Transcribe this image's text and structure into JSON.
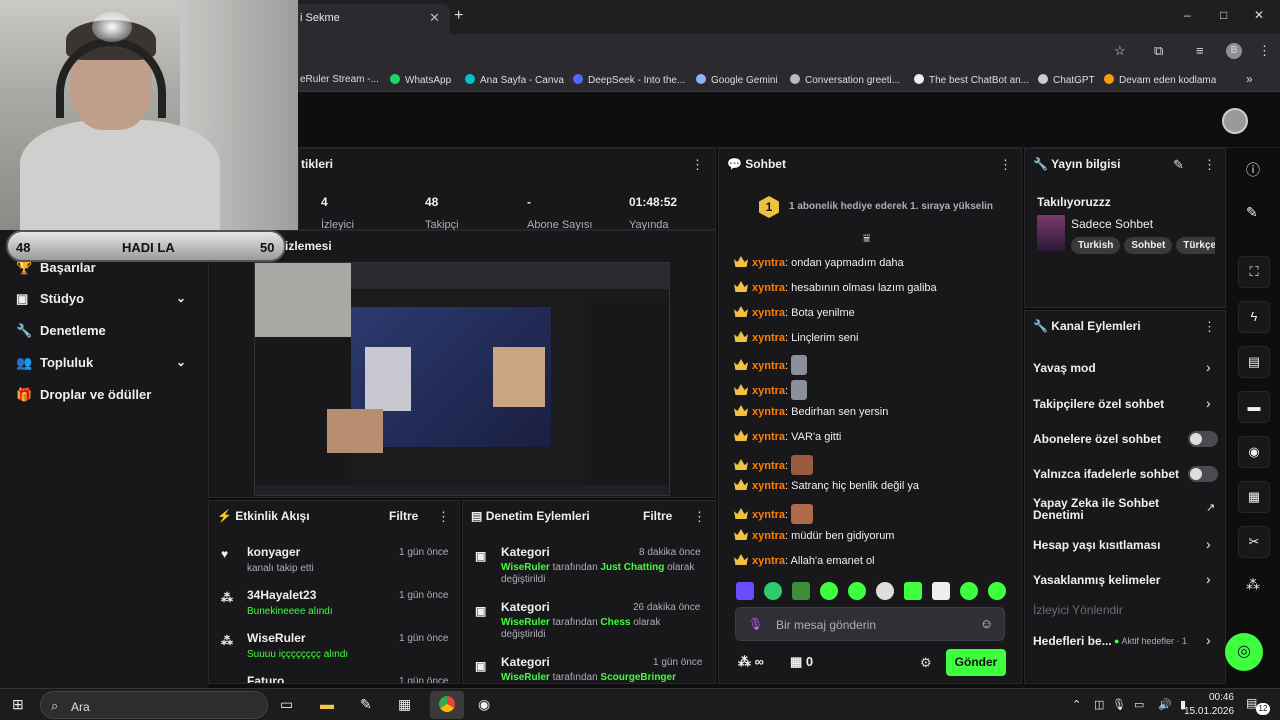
{
  "browser": {
    "tab_title": "i Sekme",
    "new_tab": "+",
    "window_controls": [
      "–",
      "□",
      "✕"
    ],
    "profile_initial": "B",
    "bookmarks": [
      {
        "label": "eRuler Stream -...",
        "color": "#9147ff"
      },
      {
        "label": "WhatsApp",
        "color": "#25d366"
      },
      {
        "label": "Ana Sayfa - Canva",
        "color": "#00c4cc"
      },
      {
        "label": "DeepSeek - Into the...",
        "color": "#4d6bfe"
      },
      {
        "label": "Google Gemini",
        "color": "#8ab4f8"
      },
      {
        "label": "Conversation greeti...",
        "color": "#bbbbbb"
      },
      {
        "label": "The best ChatBot an...",
        "color": "#eeeeee"
      },
      {
        "label": "ChatGPT",
        "color": "#cccccc"
      },
      {
        "label": "Devam eden kodlama",
        "color": "#f59e0b"
      }
    ],
    "more_bookmarks": "»"
  },
  "overlay": {
    "left_value": "48",
    "label": "HADI LA",
    "right_value": "50"
  },
  "stats_panel": {
    "title": "tikleri",
    "stats": [
      {
        "value": "4",
        "label": "İzleyici"
      },
      {
        "value": "48",
        "label": "Takipçi"
      },
      {
        "value": "-",
        "label": "Abone Sayısı"
      },
      {
        "value": "01:48:52",
        "label": "Yayında"
      }
    ]
  },
  "preview_panel": {
    "title": "izlemesi"
  },
  "left_nav": {
    "items": [
      {
        "label": "Başarılar",
        "icon": "trophy-icon",
        "glyph": "🏆"
      },
      {
        "label": "Stüdyo",
        "icon": "studio-icon",
        "glyph": "▣",
        "chevron": true
      },
      {
        "label": "Denetleme",
        "icon": "wrench-icon",
        "glyph": "🔧"
      },
      {
        "label": "Topluluk",
        "icon": "community-icon",
        "glyph": "👥",
        "chevron": true
      },
      {
        "label": "Droplar ve ödüller",
        "icon": "gift-icon",
        "glyph": "🎁"
      }
    ]
  },
  "activity_feed": {
    "title": "Etkinlik Akışı",
    "filter": "Filtre",
    "items": [
      {
        "name": "konyager",
        "detail": "kanalı takip etti",
        "time": "1 gün önce"
      },
      {
        "name": "34Hayalet23",
        "detail": "Bunekineeee alındı",
        "time": "1 gün önce"
      },
      {
        "name": "WiseRuler",
        "detail": "Suuuu içççççççç alındı",
        "time": "1 gün önce"
      },
      {
        "name": "Faturo",
        "detail": "",
        "time": "1 gün önce"
      }
    ]
  },
  "mod_actions": {
    "title": "Denetim Eylemleri",
    "filter": "Filtre",
    "items": [
      {
        "title": "Kategori",
        "user": "WiseRuler",
        "mid": " tarafından ",
        "target": "Just Chatting",
        "tail": " olarak değiştirildi",
        "time": "8 dakika önce"
      },
      {
        "title": "Kategori",
        "user": "WiseRuler",
        "mid": " tarafından ",
        "target": "Chess",
        "tail": " olarak değiştirildi",
        "time": "26 dakika önce"
      },
      {
        "title": "Kategori",
        "user": "WiseRuler",
        "mid": " tarafından ",
        "target": "ScourgeBringer",
        "tail": "",
        "time": "1 gün önce"
      }
    ]
  },
  "chat": {
    "title": "Sohbet",
    "gift_rank": "1",
    "gift_text": "1 abonelik hediye ederek 1. sıraya yükselin",
    "messages": [
      {
        "user": "xyntra",
        "text": ": ondan yapmadım daha"
      },
      {
        "user": "xyntra",
        "text": ": hesabının olması lazım galiba"
      },
      {
        "user": "xyntra",
        "text": ": Bota yenilme"
      },
      {
        "user": "xyntra",
        "text": ": Linçlerim seni"
      },
      {
        "user": "xyntra",
        "text": ":",
        "emote": "#8a8f99"
      },
      {
        "user": "xyntra",
        "text": ":",
        "emote": "#8a8f99"
      },
      {
        "user": "xyntra",
        "text": ": Bedirhan sen yersin"
      },
      {
        "user": "xyntra",
        "text": ": VAR'a gitti"
      },
      {
        "user": "xyntra",
        "text": ":",
        "emote": "#9a5a40"
      },
      {
        "user": "xyntra",
        "text": ": Satranç hiç benlik değil ya"
      },
      {
        "user": "xyntra",
        "text": ":",
        "emote": "#b06a4a"
      },
      {
        "user": "xyntra",
        "text": ": müdür ben gidiyorum"
      },
      {
        "user": "xyntra",
        "text": ": Allah'a emanet ol"
      }
    ],
    "input_placeholder": "Bir mesaj gönderin",
    "points": "∞",
    "drops": "0",
    "send": "Gönder"
  },
  "stream_info": {
    "title": "Yayın bilgisi",
    "stream_title": "Takılıyoruzzz",
    "category": "Sadece Sohbet",
    "tags": [
      "Turkish",
      "Sohbet",
      "Türkçe"
    ]
  },
  "channel_actions": {
    "title": "Kanal Eylemleri",
    "items": [
      {
        "label": "Yavaş mod",
        "control": "chevron"
      },
      {
        "label": "Takipçilere özel sohbet",
        "control": "chevron"
      },
      {
        "label": "Abonelere özel sohbet",
        "control": "toggle",
        "on": false
      },
      {
        "label": "Yalnızca ifadelerle sohbet",
        "control": "toggle",
        "on": false
      },
      {
        "label": "Yapay Zeka ile Sohbet Denetimi",
        "control": "external"
      },
      {
        "label": "Hesap yaşı kısıtlaması",
        "control": "chevron"
      },
      {
        "label": "Yasaklanmış kelimeler",
        "control": "chevron"
      },
      {
        "label": "İzleyici Yönlendir",
        "control": "none",
        "disabled": true
      },
      {
        "label": "Hedefleri be...",
        "control": "chevron",
        "extra": "Aktif hedefler · 1"
      }
    ]
  },
  "taskbar": {
    "search": "Ara",
    "time": "00:46",
    "date": "15.01.2026",
    "notif_count": "12"
  },
  "colors": {
    "accent": "#3eff3e",
    "username": "#ff7f00",
    "crown": "#f0c040",
    "panel": "#18181b"
  }
}
